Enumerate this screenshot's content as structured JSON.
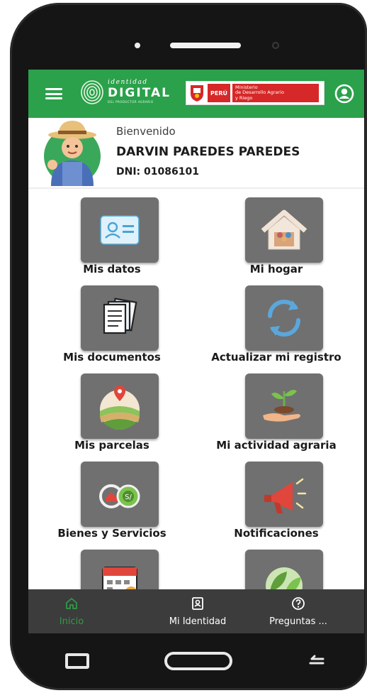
{
  "app_bar": {
    "brand_top": "identidad",
    "brand_main": "DIGITAL",
    "brand_sub": "DEL PRODUCTOR AGRARIO",
    "peru_badge": "PERÚ",
    "ministry_name": "Ministerio\nde Desarrollo Agrario\ny Riego",
    "color": "#2aa14a",
    "icons": {
      "menu": "menu-icon",
      "logo": "fingerprint-icon",
      "profile": "user-circle-icon",
      "shield": "peru-shield-icon"
    }
  },
  "welcome": {
    "greeting": "Bienvenido",
    "user_name": "DARVIN PAREDES PAREDES",
    "dni": "DNI: 01086101",
    "avatar_icon": "farmer-avatar-icon"
  },
  "tiles": [
    {
      "label": "Mis datos",
      "icon": "id-card-icon"
    },
    {
      "label": "Mi hogar",
      "icon": "house-family-icon"
    },
    {
      "label": "Mis documentos",
      "icon": "documents-icon"
    },
    {
      "label": "Actualizar mi registro",
      "icon": "refresh-icon"
    },
    {
      "label": "Mis parcelas",
      "icon": "farm-plot-icon"
    },
    {
      "label": "Mi actividad agraria",
      "icon": "plant-hand-icon"
    },
    {
      "label": "Bienes y Servicios",
      "icon": "goods-services-icon"
    },
    {
      "label": "Notificaciones",
      "icon": "megaphone-icon"
    },
    {
      "label": "",
      "icon": "calendar-icon"
    },
    {
      "label": "",
      "icon": "leaves-icon"
    }
  ],
  "bottom_nav": {
    "items": [
      {
        "label": "Inicio",
        "icon": "home-icon",
        "active": true
      },
      {
        "label": "Mi Identidad",
        "icon": "id-badge-icon",
        "active": false
      },
      {
        "label": "Preguntas ...",
        "icon": "question-icon",
        "active": false
      }
    ],
    "active_color": "#2e9b45",
    "background": "#3c3c3c"
  }
}
